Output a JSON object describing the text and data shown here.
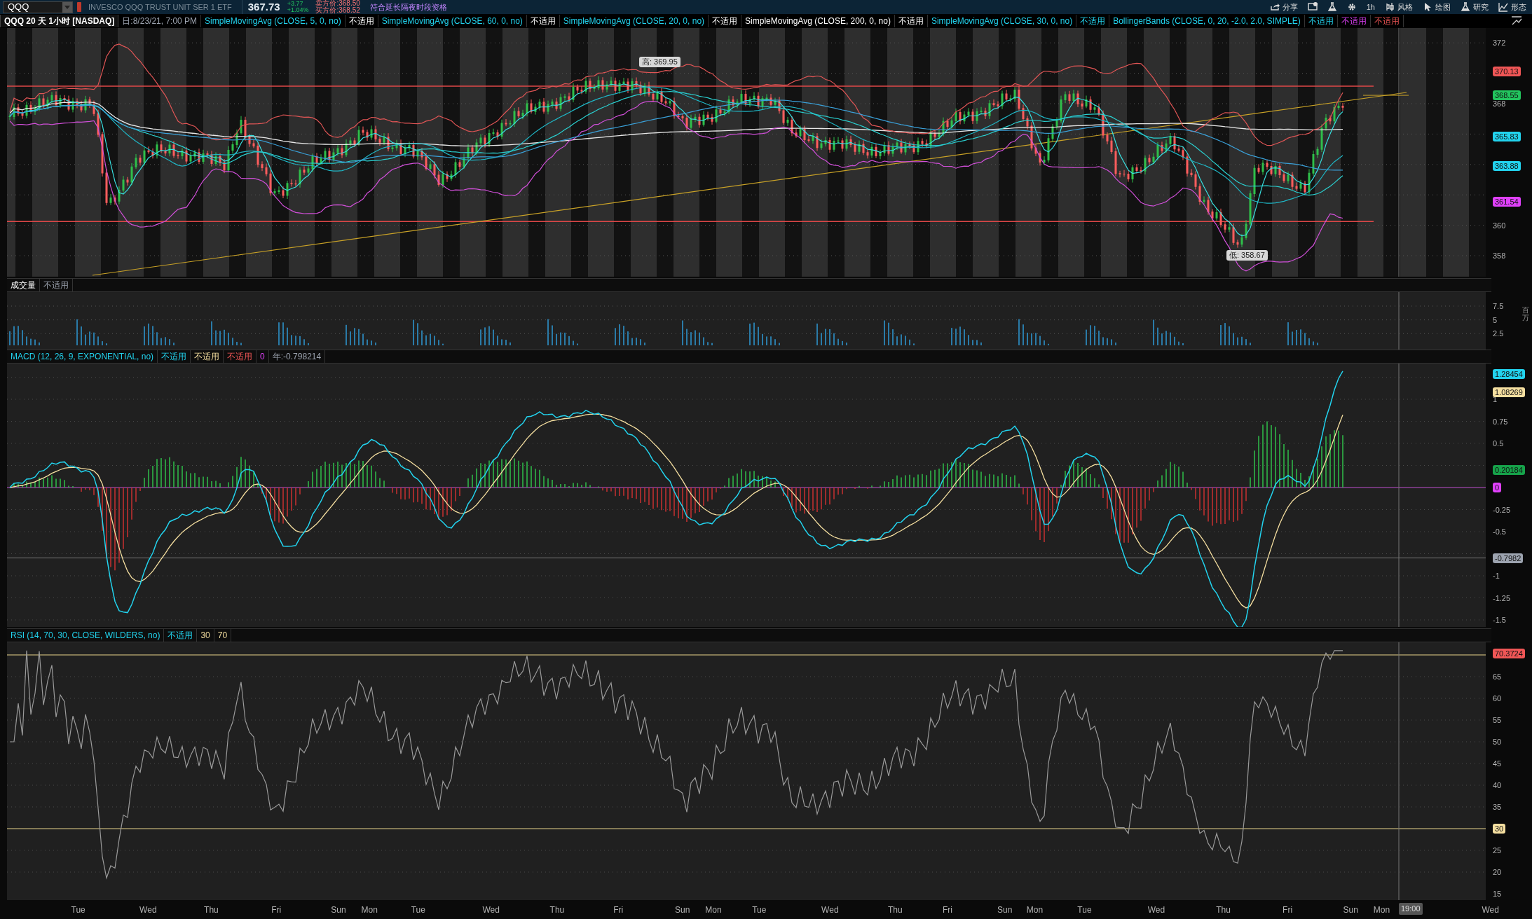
{
  "toolbar": {
    "symbol": "QQQ",
    "description": "INVESCO QQQ TRUST UNIT SER 1 ETF",
    "last": "367.73",
    "change": "+3.77",
    "change_percent": "+1.04%",
    "quote_lines": [
      "卖方价:368.50",
      "买方价:368.52"
    ],
    "notice": "符合延长隔夜时段资格",
    "buttons": [
      {
        "kind": "share",
        "label": "分享"
      },
      {
        "kind": "alert"
      },
      {
        "kind": "flask"
      },
      {
        "kind": "gear"
      },
      {
        "kind": "text",
        "label": "1h"
      },
      {
        "kind": "style",
        "label": "风格"
      },
      {
        "kind": "draw",
        "label": "绘图"
      },
      {
        "kind": "study",
        "label": "研究"
      },
      {
        "kind": "pattern",
        "label": "形态"
      }
    ]
  },
  "studies_bar": [
    {
      "kind": "title",
      "text": "QQQ 20 天 1小时 [NASDAQ]"
    },
    {
      "kind": "plain",
      "text": "日:8/23/21, 7:00 PM"
    },
    {
      "kind": "study",
      "text": "SimpleMovingAvg (CLOSE, 5, 0, no)"
    },
    {
      "kind": "value",
      "text": "不适用"
    },
    {
      "kind": "study",
      "text": "SimpleMovingAvg (CLOSE, 60, 0, no)"
    },
    {
      "kind": "value",
      "text": "不适用"
    },
    {
      "kind": "study",
      "text": "SimpleMovingAvg (CLOSE, 20, 0, no)"
    },
    {
      "kind": "value",
      "text": "不适用"
    },
    {
      "kind": "long_average",
      "text": "SimpleMovingAvg (CLOSE, 200, 0, no)"
    },
    {
      "kind": "value",
      "text": "不适用"
    },
    {
      "kind": "study",
      "text": "SimpleMovingAvg (CLOSE, 30, 0, no)"
    },
    {
      "kind": "plot",
      "text": "不适用"
    },
    {
      "kind": "study",
      "text": "BollingerBands (CLOSE, 0, 20, -2.0, 2.0, SIMPLE)"
    },
    {
      "kind": "plot",
      "text": "不适用"
    },
    {
      "kind": "lower_band",
      "text": "不适用"
    },
    {
      "kind": "upper_band",
      "text": "不适用"
    }
  ],
  "price_pane": {
    "ticks": [
      "372",
      "368",
      "360",
      "358"
    ],
    "markers": [
      {
        "text": "370.13",
        "color": "#f05656"
      },
      {
        "text": "368.55",
        "color": "#22c55e"
      },
      {
        "text": "365.83",
        "color": "#22d3ee"
      },
      {
        "text": "363.88",
        "color": "#22d3ee"
      },
      {
        "text": "361.54",
        "color": "#e040fb"
      }
    ],
    "high_bubble": "高: 369.95",
    "low_bubble": "低: 358.67"
  },
  "volume_pane": {
    "header": [
      {
        "text": "成交量",
        "kind": "name"
      },
      {
        "text": "不适用",
        "kind": "readout"
      }
    ],
    "ticks": [
      "7.5",
      "5",
      "2.5"
    ],
    "unit": "百万"
  },
  "macd_pane": {
    "header": [
      {
        "text": "MACD (12, 26, 9, EXPONENTIAL, no)",
        "kind": "study"
      },
      {
        "text": "不适用",
        "kind": "plot"
      },
      {
        "text": "不适用",
        "kind": "signal"
      },
      {
        "text": "不适用",
        "kind": "upper_band"
      },
      {
        "text": "0",
        "kind": "lower_band"
      },
      {
        "text": "年:-0.798214",
        "kind": "readout"
      }
    ],
    "ticks": [
      "1",
      "0.75",
      "0.5",
      "-0.25",
      "-0.5",
      "-1",
      "-1.25",
      "-1.5"
    ],
    "markers": [
      {
        "text": "1.28454",
        "color": "#22d3ee"
      },
      {
        "text": "1.08269",
        "color": "#f5dfa0"
      },
      {
        "text": "0.20184",
        "color": "#16a34a"
      },
      {
        "text": "0",
        "color": "#e040fb"
      },
      {
        "text": "-0.7982",
        "color": "#9ca3af"
      }
    ]
  },
  "rsi_pane": {
    "header": [
      {
        "text": "RSI (14, 70, 30, CLOSE, WILDERS, no)",
        "kind": "study"
      },
      {
        "text": "不适用",
        "kind": "plot"
      },
      {
        "text": "30",
        "kind": "signal"
      },
      {
        "text": "70",
        "kind": "signal"
      }
    ],
    "ticks": [
      "65",
      "60",
      "55",
      "50",
      "45",
      "40",
      "35",
      "25",
      "20",
      "15"
    ],
    "markers": [
      {
        "text": "70.3724",
        "color": "#f05656"
      },
      {
        "text": "30",
        "color": "#f5dfa0"
      }
    ]
  },
  "time_axis": [
    "Tue",
    "Wed",
    "Thu",
    "Fri",
    "Sun",
    "Mon",
    "Tue",
    "Wed",
    "Thu",
    "Fri",
    "Sun",
    "Mon",
    "Tue",
    "Wed",
    "Thu",
    "Fri",
    "Sun",
    "Mon",
    "Tue",
    "Wed",
    "Thu",
    "Fri",
    "Sun",
    "Mon",
    "Wed"
  ],
  "time_marker": "19:00"
}
